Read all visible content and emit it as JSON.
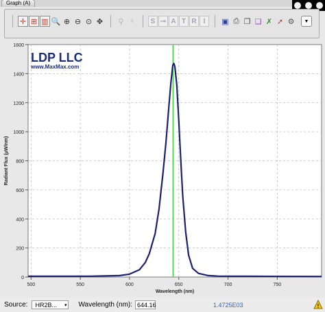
{
  "tabs": [
    {
      "label": "Graph (A)"
    }
  ],
  "toolbar": {
    "buttons_left": [
      {
        "icon": "crosshair-icon",
        "glyph": "✛",
        "color": "#c0392b"
      },
      {
        "icon": "grid-icon",
        "glyph": "⊞",
        "color": "#c0392b"
      },
      {
        "icon": "battery-icon",
        "glyph": "▥",
        "color": "#c0392b"
      },
      {
        "icon": "zoom-box-icon",
        "glyph": "🔍",
        "color": "#333333"
      },
      {
        "icon": "zoom-in-icon",
        "glyph": "⊕",
        "color": "#333333"
      },
      {
        "icon": "zoom-out-icon",
        "glyph": "⊖",
        "color": "#333333"
      },
      {
        "icon": "zoom-fit-icon",
        "glyph": "⊙",
        "color": "#333333"
      },
      {
        "icon": "pan-icon",
        "glyph": "✥",
        "color": "#333333"
      }
    ],
    "buttons_mid": [
      {
        "icon": "pin-icon",
        "glyph": "⚲"
      },
      {
        "icon": "bulb-icon",
        "glyph": "♀"
      }
    ],
    "letter_buttons": [
      "S",
      "⊸",
      "A",
      "T",
      "R",
      "I"
    ],
    "buttons_right": [
      {
        "icon": "save-icon",
        "glyph": "▣",
        "color": "#2c3e8f"
      },
      {
        "icon": "print-icon",
        "glyph": "⎙",
        "color": "#444444"
      },
      {
        "icon": "copy-icon",
        "glyph": "❐",
        "color": "#444444"
      },
      {
        "icon": "copy-data-icon",
        "glyph": "❏",
        "color": "#8e44ad"
      },
      {
        "icon": "overlay-icon",
        "glyph": "✗",
        "color": "#2e8b2e"
      },
      {
        "icon": "export-icon",
        "glyph": "➚",
        "color": "#c0392b"
      },
      {
        "icon": "settings-icon",
        "glyph": "⚙",
        "color": "#555555"
      }
    ],
    "menu_glyph": "▼"
  },
  "logo": {
    "title": "LDP LLC",
    "url": "www.MaxMax.com"
  },
  "chart_data": {
    "type": "line",
    "xlabel": "Wavelength (nm)",
    "ylabel": "Radiant Flux (µW/nm)",
    "xlim": [
      497,
      795
    ],
    "ylim": [
      0,
      1600
    ],
    "xticks": [
      500,
      550,
      600,
      650,
      700,
      750
    ],
    "yticks": [
      0,
      200,
      400,
      600,
      800,
      1000,
      1200,
      1400,
      1600
    ],
    "grid": true,
    "marker_x": 644.16,
    "series": [
      {
        "color": "#1a1f6e",
        "x": [
          497,
          560,
          590,
          600,
          610,
          616,
          620,
          626,
          630,
          634,
          637,
          640,
          642,
          644,
          645,
          646,
          648,
          650,
          652,
          654,
          657,
          660,
          664,
          670,
          680,
          690,
          700,
          720,
          795
        ],
        "y": [
          5,
          5,
          10,
          20,
          50,
          100,
          160,
          300,
          470,
          720,
          930,
          1180,
          1340,
          1460,
          1470,
          1450,
          1320,
          1080,
          810,
          560,
          310,
          150,
          60,
          25,
          10,
          6,
          5,
          5,
          4
        ]
      }
    ]
  },
  "status": {
    "source_label": "Source:",
    "source_value": "HR2B...",
    "wavelength_label": "Wavelength (nm):",
    "wavelength_value": "644.16",
    "readout": "1.4725E03"
  }
}
